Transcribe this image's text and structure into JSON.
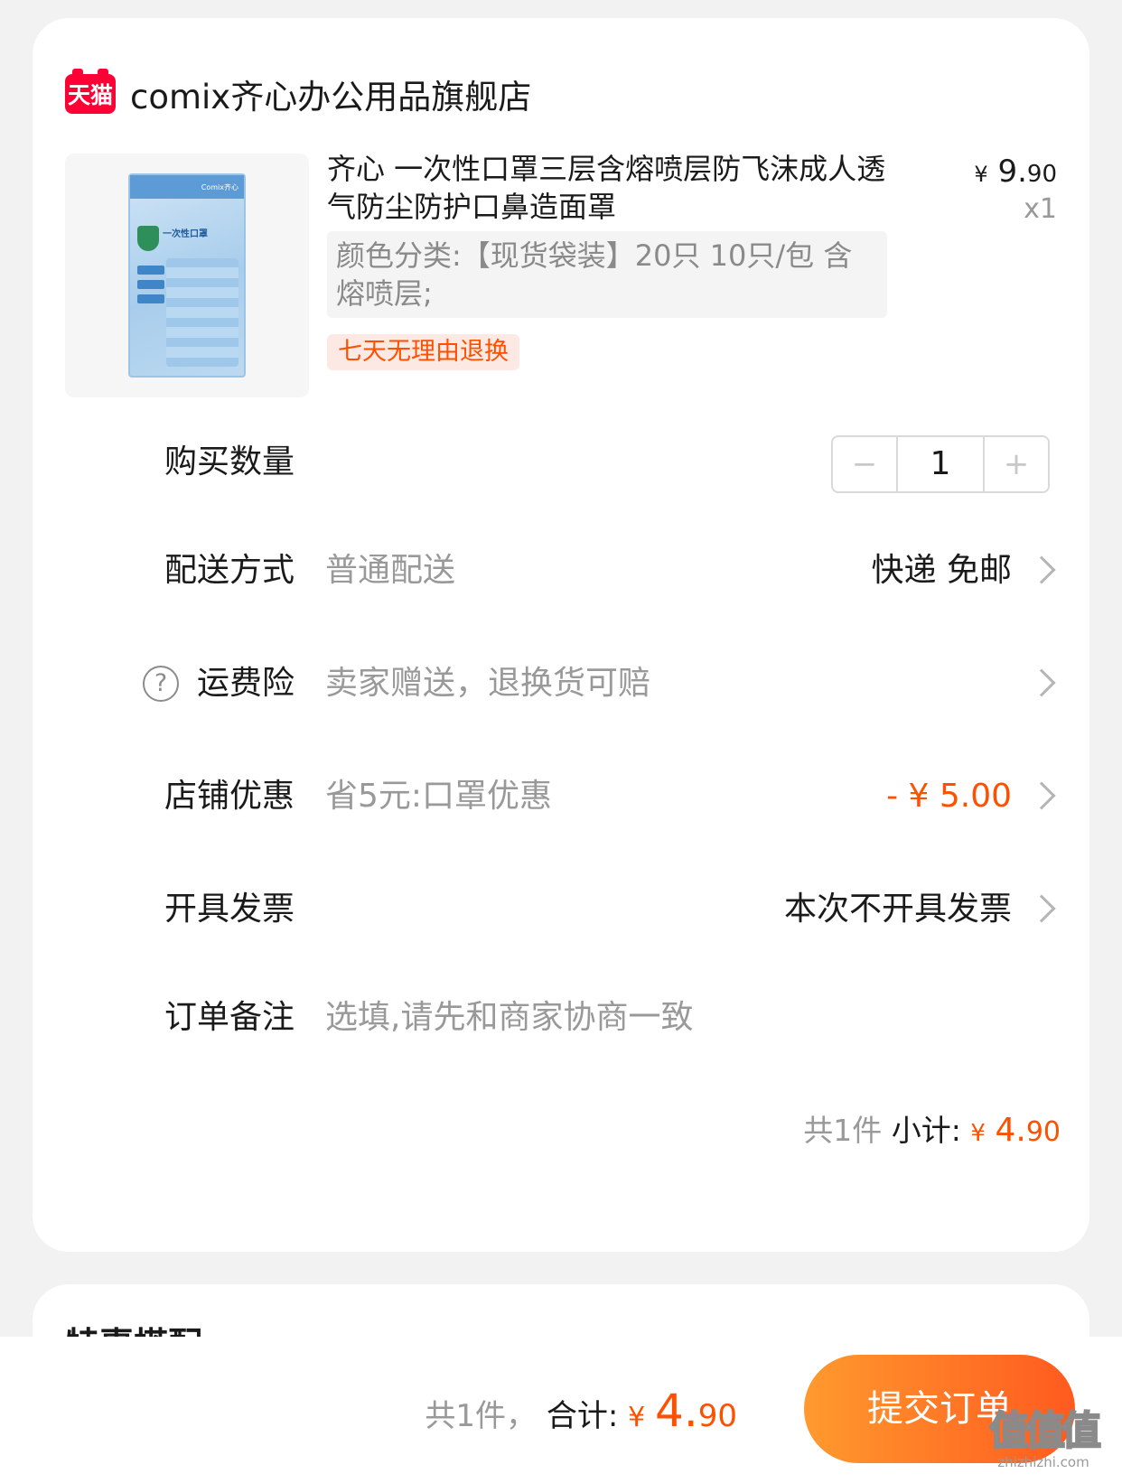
{
  "store": {
    "badge": "天猫",
    "name": "comix齐心办公用品旗舰店"
  },
  "product": {
    "title": "齐心 一次性口罩三层含熔喷层防飞沫成人透气防尘防护口鼻造面罩",
    "price_symbol": "¥",
    "price_int": "9.",
    "price_cents": "90",
    "quantity": "x1",
    "sku": "颜色分类:【现货袋装】20只 10只/包 含熔喷层;",
    "return_tag": "七天无理由退换",
    "package": {
      "brand": "Comix齐心",
      "title": "一次性口罩"
    }
  },
  "rows": {
    "quantity": {
      "label": "购买数量",
      "value": "1",
      "minus": "−",
      "plus": "+"
    },
    "delivery": {
      "label": "配送方式",
      "sub": "普通配送",
      "value": "快递 免邮"
    },
    "insurance": {
      "label": "运费险",
      "sub": "卖家赠送，退换货可赔",
      "help": "?"
    },
    "discount": {
      "label": "店铺优惠",
      "sub": "省5元:口罩优惠",
      "value": "- ¥ 5.00"
    },
    "invoice": {
      "label": "开具发票",
      "value": "本次不开具发票"
    },
    "note": {
      "label": "订单备注",
      "placeholder": "选填,请先和商家协商一致"
    }
  },
  "subtotal": {
    "count": "共1件",
    "label": "小计:",
    "yen": "¥",
    "int": "4.",
    "cents": "90"
  },
  "combo": {
    "title": "特惠搭配"
  },
  "footer": {
    "count": "共1件，",
    "label": "合计:",
    "yen": "¥",
    "int": "4.",
    "cents": "90",
    "submit": "提交订单"
  },
  "watermark": {
    "text": "值值值",
    "url": "zhizhizhi.com"
  },
  "colors": {
    "accent": "#ff5000",
    "tmall_red": "#ff0036",
    "button_start": "#ff9a2e",
    "button_end": "#ff5a1f"
  }
}
